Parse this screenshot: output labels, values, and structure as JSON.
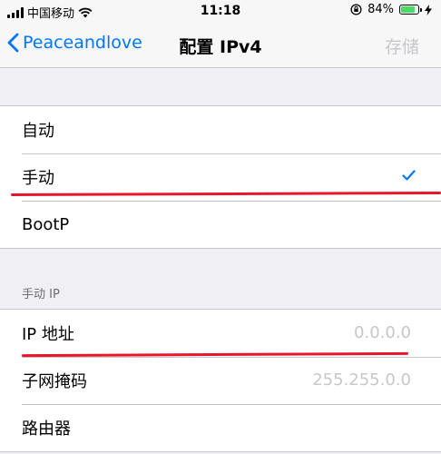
{
  "status_bar": {
    "carrier": "中国移动",
    "time": "11:18",
    "battery_percent": "84%",
    "battery_level": 0.84,
    "battery_color": "#4cd964"
  },
  "nav": {
    "back_label": "Peaceandlove",
    "title": "配置 IPv4",
    "save_label": "存储",
    "accent_color": "#0076ff"
  },
  "config_options": [
    {
      "label": "自动",
      "selected": false
    },
    {
      "label": "手动",
      "selected": true
    },
    {
      "label": "BootP",
      "selected": false
    }
  ],
  "manual_ip": {
    "section_title": "手动 IP",
    "fields": [
      {
        "label": "IP 地址",
        "value": "0.0.0.0"
      },
      {
        "label": "子网掩码",
        "value": "255.255.0.0"
      },
      {
        "label": "路由器",
        "value": ""
      }
    ]
  },
  "icons": {
    "back": "chevron-left-icon",
    "check": "checkmark-icon",
    "wifi": "wifi-icon",
    "lock_rotation": "rotation-lock-icon",
    "charging": "charging-bolt-icon"
  }
}
